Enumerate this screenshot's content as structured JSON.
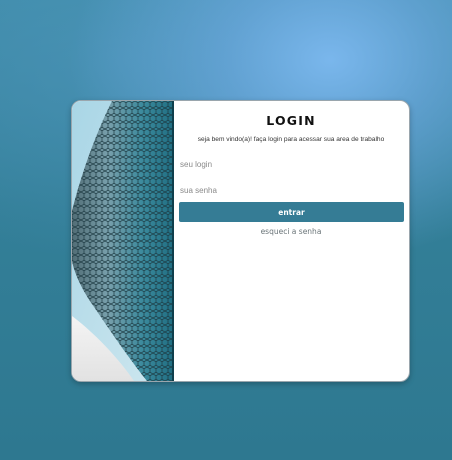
{
  "login": {
    "title": "LOGIN",
    "subtitle": "seja bem vindo(a)! faça login para acessar sua area de trabalho",
    "login_placeholder": "seu login",
    "password_placeholder": "sua senha",
    "submit_label": "entrar",
    "forgot_label": "esqueci a senha"
  },
  "colors": {
    "accent": "#357c95",
    "background": "#2e7890",
    "card": "#ffffff"
  },
  "hero_image": {
    "subject": "curved metallic hexagonal-tiled building facade against a pale sky"
  }
}
